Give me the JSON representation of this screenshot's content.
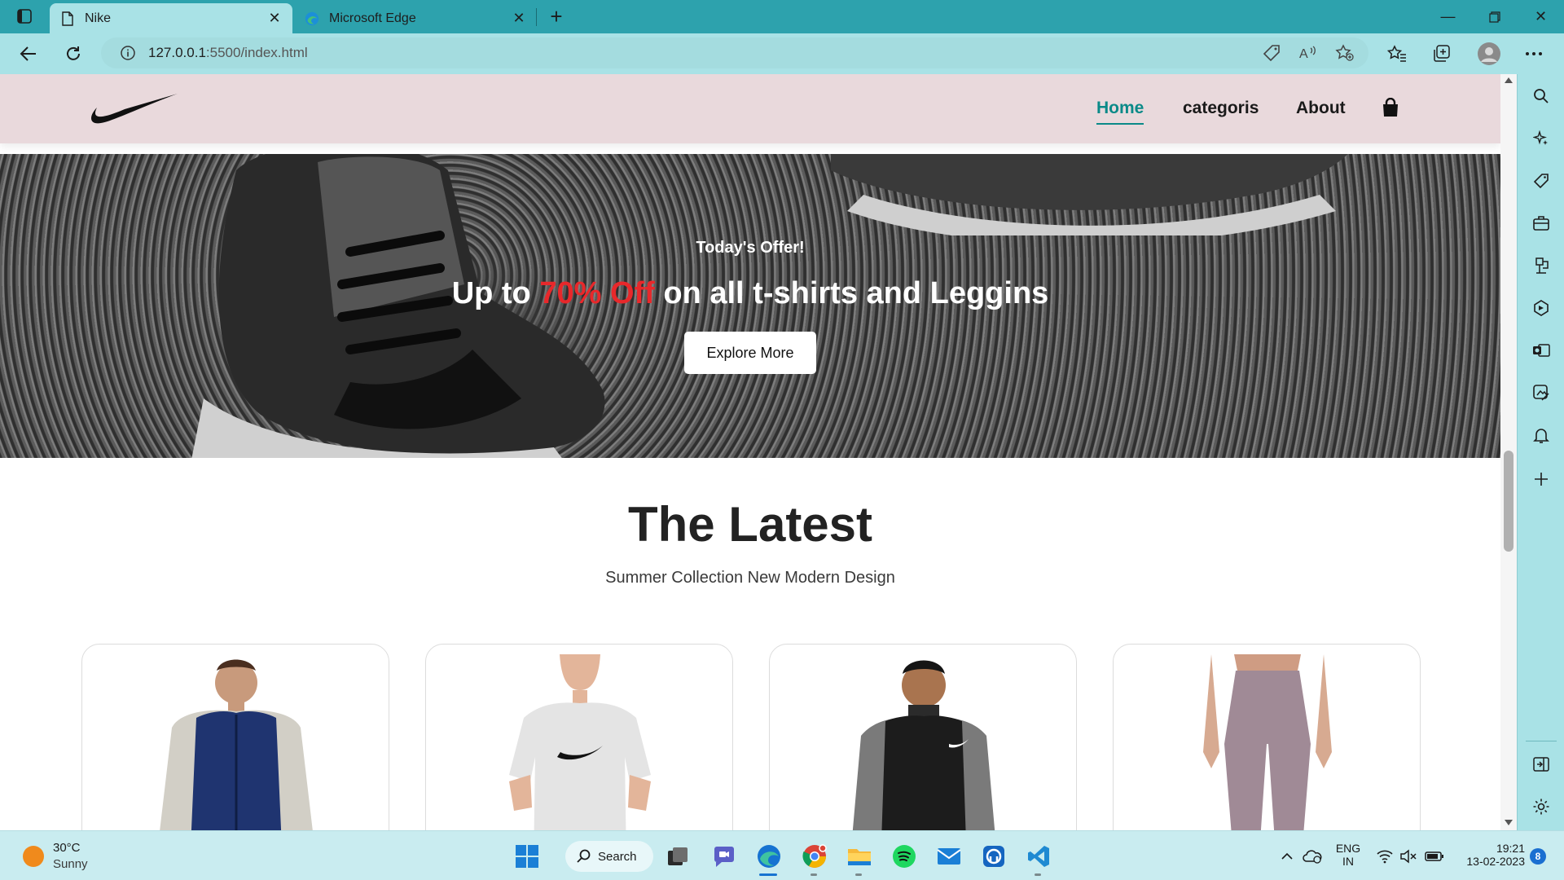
{
  "browser": {
    "tabs": [
      {
        "title": "Nike",
        "active": true
      },
      {
        "title": "Microsoft Edge",
        "active": false
      }
    ],
    "address": {
      "host": "127.0.0.1",
      "path": ":5500/index.html"
    }
  },
  "site": {
    "brand_color": "#0a8a88",
    "header_bg": "#e9d9dc",
    "nav": [
      {
        "label": "Home",
        "active": true
      },
      {
        "label": "categoris",
        "active": false
      },
      {
        "label": "About",
        "active": false
      }
    ],
    "hero": {
      "offer": "Today's Offer!",
      "headline_prefix": "Up to ",
      "headline_highlight": "70% Off",
      "headline_suffix": " on all t-shirts and Leggins",
      "highlight_color": "#e8282b",
      "button": "Explore More"
    },
    "latest": {
      "title": "The Latest",
      "subtitle": "Summer Collection New Modern Design"
    },
    "products": [
      {
        "icon": "vest-jacket-product"
      },
      {
        "icon": "white-tshirt-product"
      },
      {
        "icon": "black-jacket-product"
      },
      {
        "icon": "mauve-leggings-product"
      }
    ]
  },
  "taskbar": {
    "weather": {
      "temp": "30°C",
      "condition": "Sunny"
    },
    "search_label": "Search",
    "language": {
      "line1": "ENG",
      "line2": "IN"
    },
    "clock": {
      "time": "19:21",
      "date": "13-02-2023"
    },
    "notifications": "8"
  }
}
